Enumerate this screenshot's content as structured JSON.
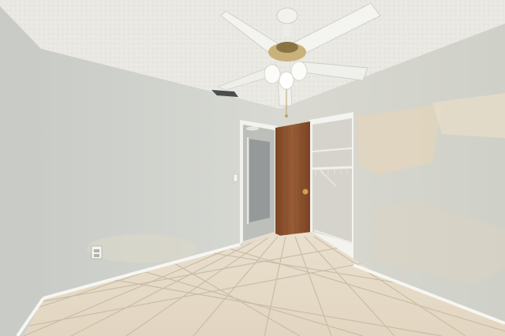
{
  "scene": {
    "icons": [
      "ceiling-fan-icon",
      "light-bulb-icon",
      "air-vent-icon",
      "light-switch-icon",
      "electrical-outlet-icon",
      "door-knob-icon"
    ],
    "colors": {
      "ceiling": "#e9e8e2",
      "wall_left": "#cfd2cd",
      "wall_back": "#d2d4cf",
      "wall_right": "#d6d6ce",
      "wall_patch": "#e0d6c2",
      "floor_tile": "#e4d9c5",
      "grout": "#c7bba6",
      "baseboard": "#f6f6f2",
      "closet_door": "#8e5430",
      "fan_blade": "#f3f3f0",
      "fan_brass": "#c9b27a"
    }
  }
}
